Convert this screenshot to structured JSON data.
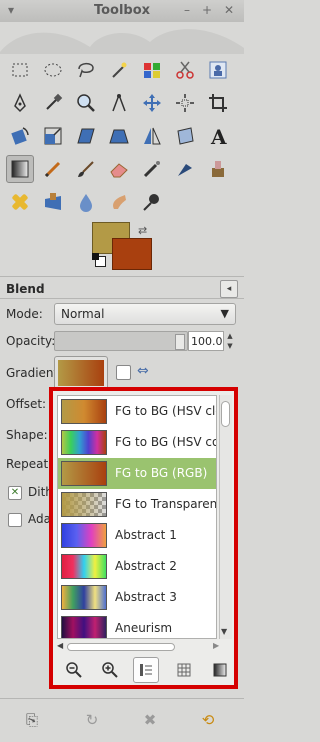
{
  "window": {
    "title": "Toolbox"
  },
  "tools": [
    {
      "name": "rect-select-icon"
    },
    {
      "name": "ellipse-select-icon"
    },
    {
      "name": "lasso-select-icon"
    },
    {
      "name": "fuzzy-select-icon"
    },
    {
      "name": "color-select-icon"
    },
    {
      "name": "scissors-select-icon"
    },
    {
      "name": "foreground-select-icon"
    },
    {
      "name": "paths-icon"
    },
    {
      "name": "color-picker-icon"
    },
    {
      "name": "zoom-icon"
    },
    {
      "name": "measure-icon"
    },
    {
      "name": "move-icon"
    },
    {
      "name": "align-icon"
    },
    {
      "name": "crop-icon"
    },
    {
      "name": "rotate-icon"
    },
    {
      "name": "scale-icon"
    },
    {
      "name": "shear-icon"
    },
    {
      "name": "perspective-icon"
    },
    {
      "name": "flip-icon"
    },
    {
      "name": "cage-icon"
    },
    {
      "name": "text-icon"
    },
    {
      "name": "blend-icon"
    },
    {
      "name": "pencil-icon"
    },
    {
      "name": "paintbrush-icon"
    },
    {
      "name": "eraser-icon"
    },
    {
      "name": "airbrush-icon"
    },
    {
      "name": "ink-icon"
    },
    {
      "name": "clone-icon"
    },
    {
      "name": "heal-icon"
    },
    {
      "name": "perspective-clone-icon"
    },
    {
      "name": "blur-icon"
    },
    {
      "name": "smudge-icon"
    },
    {
      "name": "dodge-burn-icon"
    }
  ],
  "colors": {
    "foreground": "#b39a46",
    "background": "#a9400f"
  },
  "options": {
    "title": "Blend",
    "mode_label": "Mode:",
    "mode_value": "Normal",
    "opacity_label": "Opacity:",
    "opacity_value": "100.0",
    "gradient_label": "Gradient:",
    "offset_label": "Offset:",
    "shape_label": "Shape:",
    "repeat_label": "Repeat:",
    "dither_label": "Dith",
    "adaptive_label": "Adap"
  },
  "popup": {
    "items": [
      {
        "label": "FG to BG (HSV clo",
        "selected": false
      },
      {
        "label": "FG to BG (HSV co",
        "selected": false
      },
      {
        "label": "FG to BG (RGB)",
        "selected": true
      },
      {
        "label": "FG to Transparent",
        "selected": false
      },
      {
        "label": "Abstract 1",
        "selected": false
      },
      {
        "label": "Abstract 2",
        "selected": false
      },
      {
        "label": "Abstract 3",
        "selected": false
      },
      {
        "label": "Aneurism",
        "selected": false
      }
    ],
    "highlight_color": "#d50000",
    "selected_color": "#9ac36f"
  }
}
